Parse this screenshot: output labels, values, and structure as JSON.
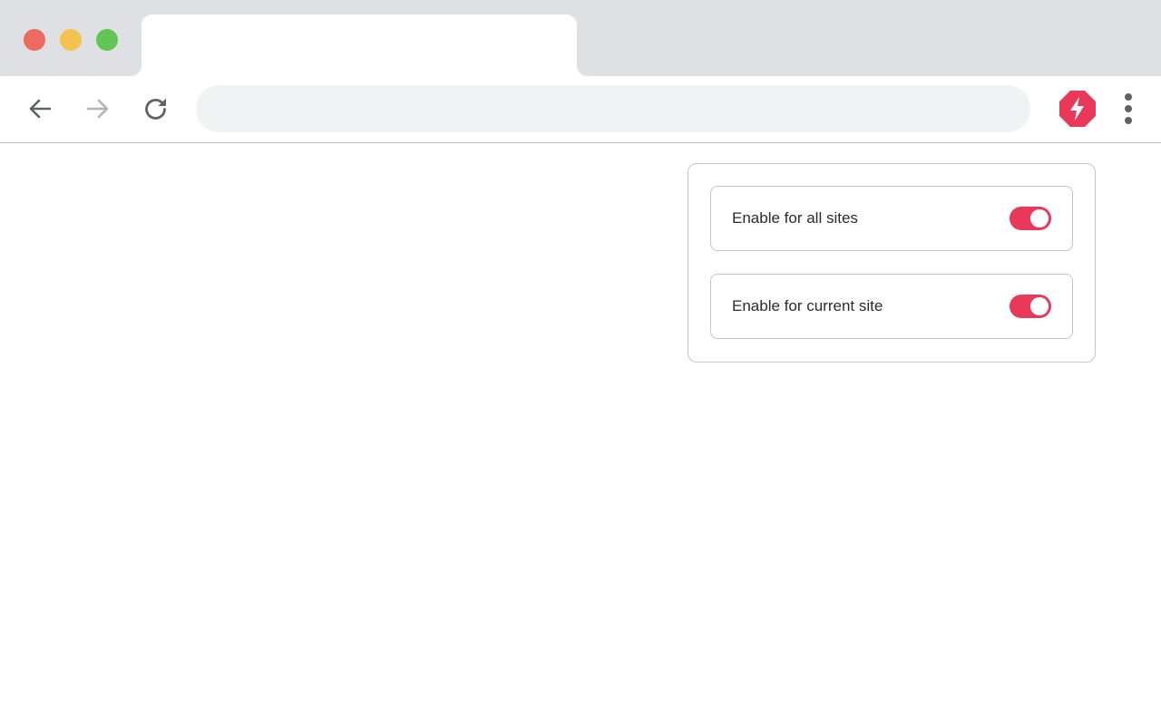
{
  "window": {
    "traffic_lights": {
      "close_color": "#ed6a5e",
      "minimize_color": "#f5c14f",
      "maximize_color": "#62c554"
    }
  },
  "tab": {
    "title": ""
  },
  "toolbar": {
    "back_icon": "arrow-left-icon",
    "forward_icon": "arrow-right-icon",
    "forward_enabled": false,
    "reload_icon": "reload-icon",
    "address": {
      "value": "",
      "placeholder": ""
    },
    "extension_icon": "lightning-stop-icon",
    "menu_icon": "kebab-menu-icon"
  },
  "popup": {
    "options": [
      {
        "label": "Enable for all sites",
        "enabled": true
      },
      {
        "label": "Enable for current site",
        "enabled": true
      }
    ]
  },
  "colors": {
    "accent": "#e8395a",
    "tab_strip": "#dfe0e4",
    "omnibox": "#f1f2f4",
    "icon_dark": "#5f6368",
    "icon_disabled": "#b3b3b3"
  }
}
